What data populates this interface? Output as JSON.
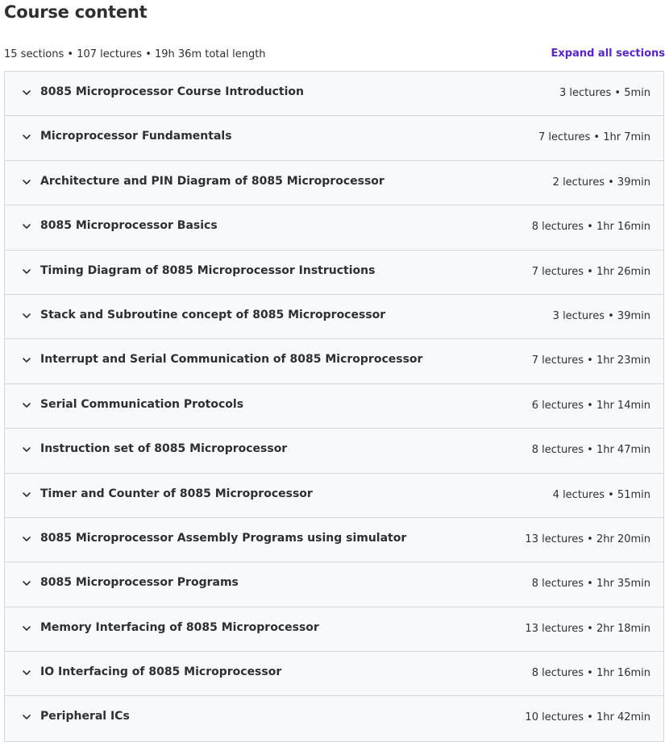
{
  "header": {
    "title": "Course content",
    "summary": "15 sections • 107 lectures • 19h 36m total length",
    "expand_all_label": "Expand all sections"
  },
  "colors": {
    "accent": "#5624d0",
    "text": "#2d2f31",
    "section_bg": "#f7f9fa",
    "border": "#d1d7dc"
  },
  "sections": [
    {
      "title": "8085 Microprocessor Course Introduction",
      "meta": "3 lectures • 5min",
      "icon": "chevron-down-icon"
    },
    {
      "title": "Microprocessor Fundamentals",
      "meta": "7 lectures • 1hr 7min",
      "icon": "chevron-down-icon"
    },
    {
      "title": "Architecture and PIN Diagram of 8085 Microprocessor",
      "meta": "2 lectures • 39min",
      "icon": "chevron-down-icon"
    },
    {
      "title": "8085 Microprocessor Basics",
      "meta": "8 lectures • 1hr 16min",
      "icon": "chevron-down-icon"
    },
    {
      "title": "Timing Diagram of 8085 Microprocessor Instructions",
      "meta": "7 lectures • 1hr 26min",
      "icon": "chevron-down-icon"
    },
    {
      "title": "Stack and Subroutine concept of 8085 Microprocessor",
      "meta": "3 lectures • 39min",
      "icon": "chevron-down-icon"
    },
    {
      "title": "Interrupt and Serial Communication of 8085 Microprocessor",
      "meta": "7 lectures • 1hr 23min",
      "icon": "chevron-down-icon"
    },
    {
      "title": "Serial Communication Protocols",
      "meta": "6 lectures • 1hr 14min",
      "icon": "chevron-down-icon"
    },
    {
      "title": "Instruction set of 8085 Microprocessor",
      "meta": "8 lectures • 1hr 47min",
      "icon": "chevron-down-icon"
    },
    {
      "title": "Timer and Counter of 8085 Microprocessor",
      "meta": "4 lectures • 51min",
      "icon": "chevron-down-icon"
    },
    {
      "title": "8085 Microprocessor Assembly Programs using simulator",
      "meta": "13 lectures • 2hr 20min",
      "icon": "chevron-down-icon"
    },
    {
      "title": "8085 Microprocessor Programs",
      "meta": "8 lectures • 1hr 35min",
      "icon": "chevron-down-icon"
    },
    {
      "title": "Memory Interfacing of 8085 Microprocessor",
      "meta": "13 lectures • 2hr 18min",
      "icon": "chevron-down-icon"
    },
    {
      "title": "IO Interfacing of 8085 Microprocessor",
      "meta": "8 lectures • 1hr 16min",
      "icon": "chevron-down-icon"
    },
    {
      "title": "Peripheral ICs",
      "meta": "10 lectures • 1hr 42min",
      "icon": "chevron-down-icon"
    }
  ]
}
